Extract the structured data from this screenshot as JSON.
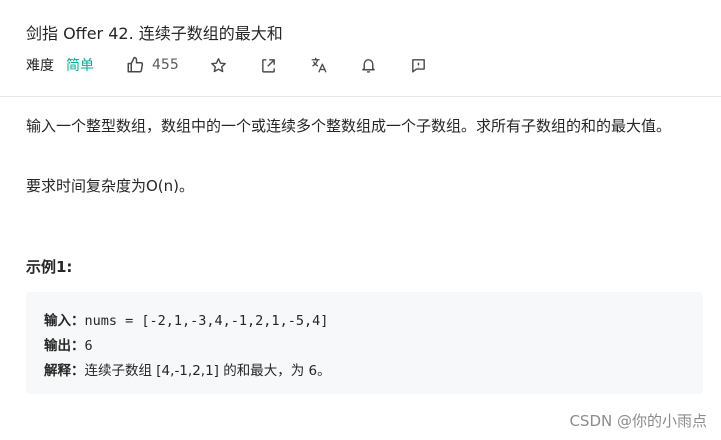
{
  "problem": {
    "title": "剑指 Offer 42. 连续子数组的最大和",
    "difficulty_label": "难度",
    "difficulty_value": "简单",
    "likes": "455"
  },
  "icons": [
    "thumbs-up-icon",
    "star-icon",
    "share-icon",
    "translate-icon",
    "bell-icon",
    "comment-icon"
  ],
  "description": {
    "paragraph1": "输入一个整型数组，数组中的一个或连续多个整数组成一个子数组。求所有子数组的和的最大值。",
    "paragraph2": "要求时间复杂度为O(n)。"
  },
  "example": {
    "title": "示例1:",
    "input_label": "输入：",
    "input_value": "nums = [-2,1,-3,4,-1,2,1,-5,4]",
    "output_label": "输出：",
    "output_value": "6",
    "explain_label": "解释：",
    "explain_text": "连续子数组 [4,-1,2,1] 的和最大，为 6。"
  },
  "watermark": "CSDN @你的小雨点",
  "colors": {
    "difficulty_easy": "#00af9b",
    "code_bg": "#f7f8fa"
  }
}
